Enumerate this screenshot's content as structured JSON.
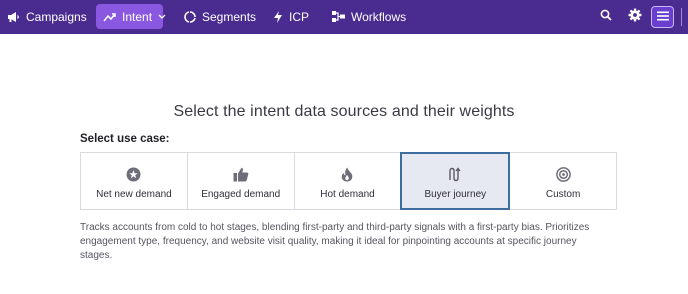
{
  "nav": {
    "items": [
      {
        "label": "Campaigns",
        "icon": "megaphone-icon"
      },
      {
        "label": "Intent",
        "icon": "trending-up-icon",
        "active": true
      },
      {
        "label": "Segments",
        "icon": "segments-icon"
      },
      {
        "label": "ICP",
        "icon": "lightning-icon"
      },
      {
        "label": "Workflows",
        "icon": "workflow-icon"
      }
    ],
    "tools": [
      "search-icon",
      "gear-icon",
      "hamburger-menu-icon"
    ]
  },
  "main": {
    "heading": "Select the intent data sources and their weights",
    "use_case_label": "Select use case:",
    "use_cases": [
      {
        "label": "Net new demand",
        "icon": "star-circle-icon"
      },
      {
        "label": "Engaged demand",
        "icon": "thumbs-up-icon"
      },
      {
        "label": "Hot demand",
        "icon": "flame-icon"
      },
      {
        "label": "Buyer journey",
        "icon": "journey-path-icon",
        "selected": true
      },
      {
        "label": "Custom",
        "icon": "target-icon"
      }
    ],
    "description": "Tracks accounts from cold to hot stages, blending first-party and third-party signals with a first-party bias. Prioritizes engagement type, frequency, and website visit quality, making it ideal for pinpointing accounts at specific journey stages."
  },
  "colors": {
    "topbar": "#4a2b8f",
    "active_tab": "#8a58e0",
    "selected_card_border": "#3d6e9e",
    "selected_card_bg": "#e6e9f1"
  }
}
